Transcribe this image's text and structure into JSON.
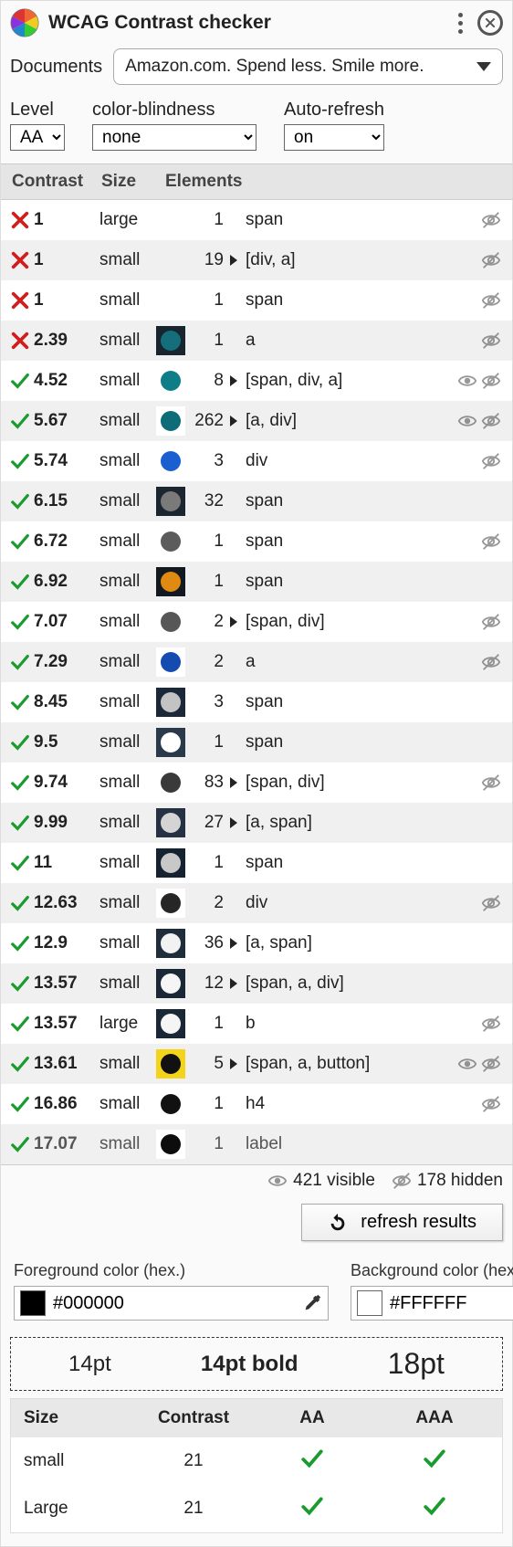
{
  "header": {
    "title": "WCAG Contrast checker"
  },
  "documents": {
    "label": "Documents",
    "selected": "Amazon.com. Spend less. Smile more."
  },
  "controls": {
    "level": {
      "label": "Level",
      "value": "AA"
    },
    "color_blindness": {
      "label": "color-blindness",
      "value": "none"
    },
    "auto_refresh": {
      "label": "Auto-refresh",
      "value": "on"
    }
  },
  "table": {
    "headers": {
      "contrast": "Contrast",
      "size": "Size",
      "elements": "Elements"
    },
    "rows": [
      {
        "pass": false,
        "contrast": "1",
        "size": "large",
        "swatch_bg": null,
        "swatch_fg": null,
        "count": "1",
        "expandable": false,
        "elements": "span",
        "eyes": [
          "hidden"
        ]
      },
      {
        "pass": false,
        "contrast": "1",
        "size": "small",
        "swatch_bg": null,
        "swatch_fg": null,
        "count": "19",
        "expandable": true,
        "elements": "[div, a]",
        "eyes": [
          "hidden"
        ]
      },
      {
        "pass": false,
        "contrast": "1",
        "size": "small",
        "swatch_bg": null,
        "swatch_fg": null,
        "count": "1",
        "expandable": false,
        "elements": "span",
        "eyes": [
          "hidden"
        ]
      },
      {
        "pass": false,
        "contrast": "2.39",
        "size": "small",
        "swatch_bg": "#16252f",
        "swatch_fg": "#146e7c",
        "count": "1",
        "expandable": false,
        "elements": "a",
        "eyes": [
          "hidden"
        ]
      },
      {
        "pass": true,
        "contrast": "4.52",
        "size": "small",
        "swatch_bg": "#ffffff",
        "swatch_fg": "#0f7d88",
        "count": "8",
        "expandable": true,
        "elements": "[span, div, a]",
        "eyes": [
          "visible",
          "hidden"
        ]
      },
      {
        "pass": true,
        "contrast": "5.67",
        "size": "small",
        "swatch_bg": "#ffffff",
        "swatch_fg": "#0d6c78",
        "count": "262",
        "expandable": true,
        "elements": "[a, div]",
        "eyes": [
          "visible",
          "hidden"
        ]
      },
      {
        "pass": true,
        "contrast": "5.74",
        "size": "small",
        "swatch_bg": "#ffffff",
        "swatch_fg": "#1a5fd0",
        "count": "3",
        "expandable": false,
        "elements": "div",
        "eyes": [
          "hidden"
        ]
      },
      {
        "pass": true,
        "contrast": "6.15",
        "size": "small",
        "swatch_bg": "#1b2631",
        "swatch_fg": "#7a7a7a",
        "count": "32",
        "expandable": false,
        "elements": "span",
        "eyes": []
      },
      {
        "pass": true,
        "contrast": "6.72",
        "size": "small",
        "swatch_bg": "#ffffff",
        "swatch_fg": "#5c5c5c",
        "count": "1",
        "expandable": false,
        "elements": "span",
        "eyes": [
          "hidden"
        ]
      },
      {
        "pass": true,
        "contrast": "6.92",
        "size": "small",
        "swatch_bg": "#131921",
        "swatch_fg": "#e08a12",
        "count": "1",
        "expandable": false,
        "elements": "span",
        "eyes": []
      },
      {
        "pass": true,
        "contrast": "7.07",
        "size": "small",
        "swatch_bg": "#ffffff",
        "swatch_fg": "#575757",
        "count": "2",
        "expandable": true,
        "elements": "[span, div]",
        "eyes": [
          "hidden"
        ]
      },
      {
        "pass": true,
        "contrast": "7.29",
        "size": "small",
        "swatch_bg": "#ffffff",
        "swatch_fg": "#134bb0",
        "count": "2",
        "expandable": false,
        "elements": "a",
        "eyes": [
          "hidden"
        ]
      },
      {
        "pass": true,
        "contrast": "8.45",
        "size": "small",
        "swatch_bg": "#1b2838",
        "swatch_fg": "#c3c3c3",
        "count": "3",
        "expandable": false,
        "elements": "span",
        "eyes": []
      },
      {
        "pass": true,
        "contrast": "9.5",
        "size": "small",
        "swatch_bg": "#2a3a4a",
        "swatch_fg": "#ffffff",
        "count": "1",
        "expandable": false,
        "elements": "span",
        "eyes": []
      },
      {
        "pass": true,
        "contrast": "9.74",
        "size": "small",
        "swatch_bg": "#ffffff",
        "swatch_fg": "#3a3a3a",
        "count": "83",
        "expandable": true,
        "elements": "[span, div]",
        "eyes": [
          "hidden"
        ]
      },
      {
        "pass": true,
        "contrast": "9.99",
        "size": "small",
        "swatch_bg": "#243244",
        "swatch_fg": "#d4d4d4",
        "count": "27",
        "expandable": true,
        "elements": "[a, span]",
        "eyes": []
      },
      {
        "pass": true,
        "contrast": "11",
        "size": "small",
        "swatch_bg": "#152230",
        "swatch_fg": "#c8c8c8",
        "count": "1",
        "expandable": false,
        "elements": "span",
        "eyes": []
      },
      {
        "pass": true,
        "contrast": "12.63",
        "size": "small",
        "swatch_bg": "#ffffff",
        "swatch_fg": "#262626",
        "count": "2",
        "expandable": false,
        "elements": "div",
        "eyes": [
          "hidden"
        ]
      },
      {
        "pass": true,
        "contrast": "12.9",
        "size": "small",
        "swatch_bg": "#1f2c3a",
        "swatch_fg": "#f2f2f2",
        "count": "36",
        "expandable": true,
        "elements": "[a, span]",
        "eyes": []
      },
      {
        "pass": true,
        "contrast": "13.57",
        "size": "small",
        "swatch_bg": "#1a2735",
        "swatch_fg": "#f5f5f5",
        "count": "12",
        "expandable": true,
        "elements": "[span, a, div]",
        "eyes": []
      },
      {
        "pass": true,
        "contrast": "13.57",
        "size": "large",
        "swatch_bg": "#1a2735",
        "swatch_fg": "#f5f5f5",
        "count": "1",
        "expandable": false,
        "elements": "b",
        "eyes": [
          "hidden"
        ]
      },
      {
        "pass": true,
        "contrast": "13.61",
        "size": "small",
        "swatch_bg": "#f3d41a",
        "swatch_fg": "#111111",
        "count": "5",
        "expandable": true,
        "elements": "[span, a, button]",
        "eyes": [
          "visible",
          "hidden"
        ]
      },
      {
        "pass": true,
        "contrast": "16.86",
        "size": "small",
        "swatch_bg": "#ffffff",
        "swatch_fg": "#111111",
        "count": "1",
        "expandable": false,
        "elements": "h4",
        "eyes": [
          "hidden"
        ]
      },
      {
        "pass": true,
        "contrast": "17.07",
        "size": "small",
        "swatch_bg": "#ffffff",
        "swatch_fg": "#0d0d0d",
        "count": "1",
        "expandable": false,
        "elements": "label",
        "eyes": [],
        "truncated": true
      }
    ]
  },
  "footer": {
    "visible_label": "421 visible",
    "hidden_label": "178 hidden",
    "refresh_label": "refresh results"
  },
  "colors": {
    "fg": {
      "label": "Foreground color (hex.)",
      "value": "#000000",
      "sample": "#000000"
    },
    "bg": {
      "label": "Background color (hex.)",
      "value": "#FFFFFF",
      "sample": "#ffffff"
    }
  },
  "sizes": {
    "s14": "14pt",
    "s14b": "14pt bold",
    "s18": "18pt"
  },
  "result_table": {
    "headers": {
      "size": "Size",
      "contrast": "Contrast",
      "aa": "AA",
      "aaa": "AAA"
    },
    "rows": [
      {
        "size": "small",
        "contrast": "21",
        "aa": true,
        "aaa": true
      },
      {
        "size": "Large",
        "contrast": "21",
        "aa": true,
        "aaa": true
      }
    ]
  }
}
